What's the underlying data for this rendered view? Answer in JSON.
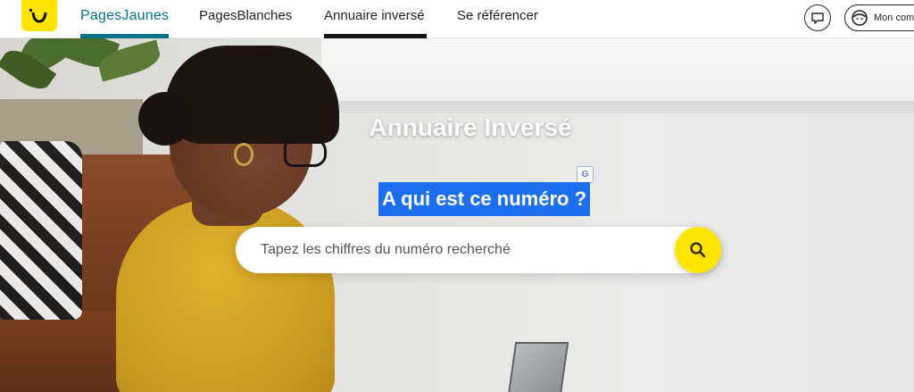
{
  "header": {
    "logo_alt": "",
    "nav": [
      {
        "label": "PagesJaunes",
        "active_brand": true
      },
      {
        "label": "PagesBlanches"
      },
      {
        "label": "Annuaire inversé",
        "current": true
      },
      {
        "label": "Se référencer"
      }
    ],
    "account_label": "Mon compte"
  },
  "hero": {
    "title": "Annuaire Inversé",
    "subtitle": "A qui est ce numéro ?",
    "translate_icon": "G"
  },
  "search": {
    "placeholder": "Tapez les chiffres du numéro recherché",
    "value": ""
  },
  "colors": {
    "brand_yellow": "#ffe400",
    "brand_teal": "#00738a",
    "selection_blue": "#1e6ef0"
  },
  "icons": {
    "logo": "smile-logo-icon",
    "chat": "chat-bubble-icon",
    "account": "user-face-icon",
    "search": "search-icon",
    "translate": "translate-icon"
  }
}
